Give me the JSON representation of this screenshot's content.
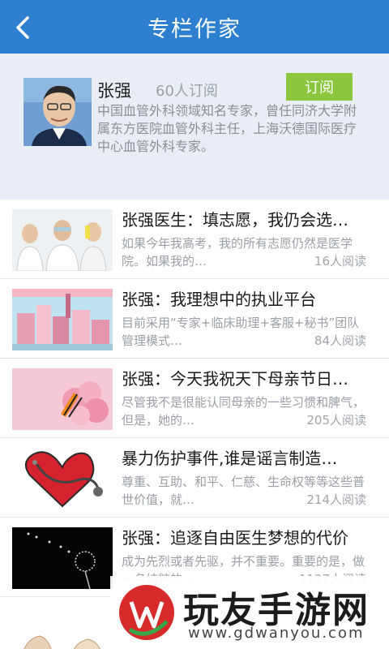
{
  "header": {
    "title": "专栏作家",
    "back_icon": "chevron-left-icon"
  },
  "profile": {
    "name": "张强",
    "subscribers": "60人订阅",
    "subscribe_label": "订阅",
    "bio": "中国血管外科领域知名专家，曾任同济大学附属东方医院血管外科主任，上海沃德国际医疗中心血管外科专家。"
  },
  "articles": [
    {
      "title": "张强医生：填志愿，我仍会选…",
      "summary": "如果今年我高考，我的所有志愿仍然是医学院。如果我的…",
      "reads": "16人阅读"
    },
    {
      "title": "张强：我理想中的执业平台",
      "summary": "目前采用“专家+临床助理+客服+秘书”团队管理模式…",
      "reads": "84人阅读"
    },
    {
      "title": "张强：今天我祝天下母亲节日…",
      "summary": "尽管我不是很能认同母亲的一些习惯和脾气，但是，她的…",
      "reads": "205人阅读"
    },
    {
      "title": "暴力伤护事件,谁是谣言制造…",
      "summary": "尊重、互助、和平、仁慈、生命权等等这些普世价值，就…",
      "reads": "214人阅读"
    },
    {
      "title": "张强：追逐自由医生梦想的代价",
      "summary": "成为先烈或者先驱，并不重要。重要的是，做一名纯粹的…",
      "reads": "1127人阅读"
    }
  ],
  "watermark": {
    "name": "玩友手游网",
    "url": "www.gdwanyou.com"
  },
  "colors": {
    "navbar": "#2d7fd0",
    "subscribe": "#8cc63f",
    "profile_bg": "#e9eef6"
  }
}
